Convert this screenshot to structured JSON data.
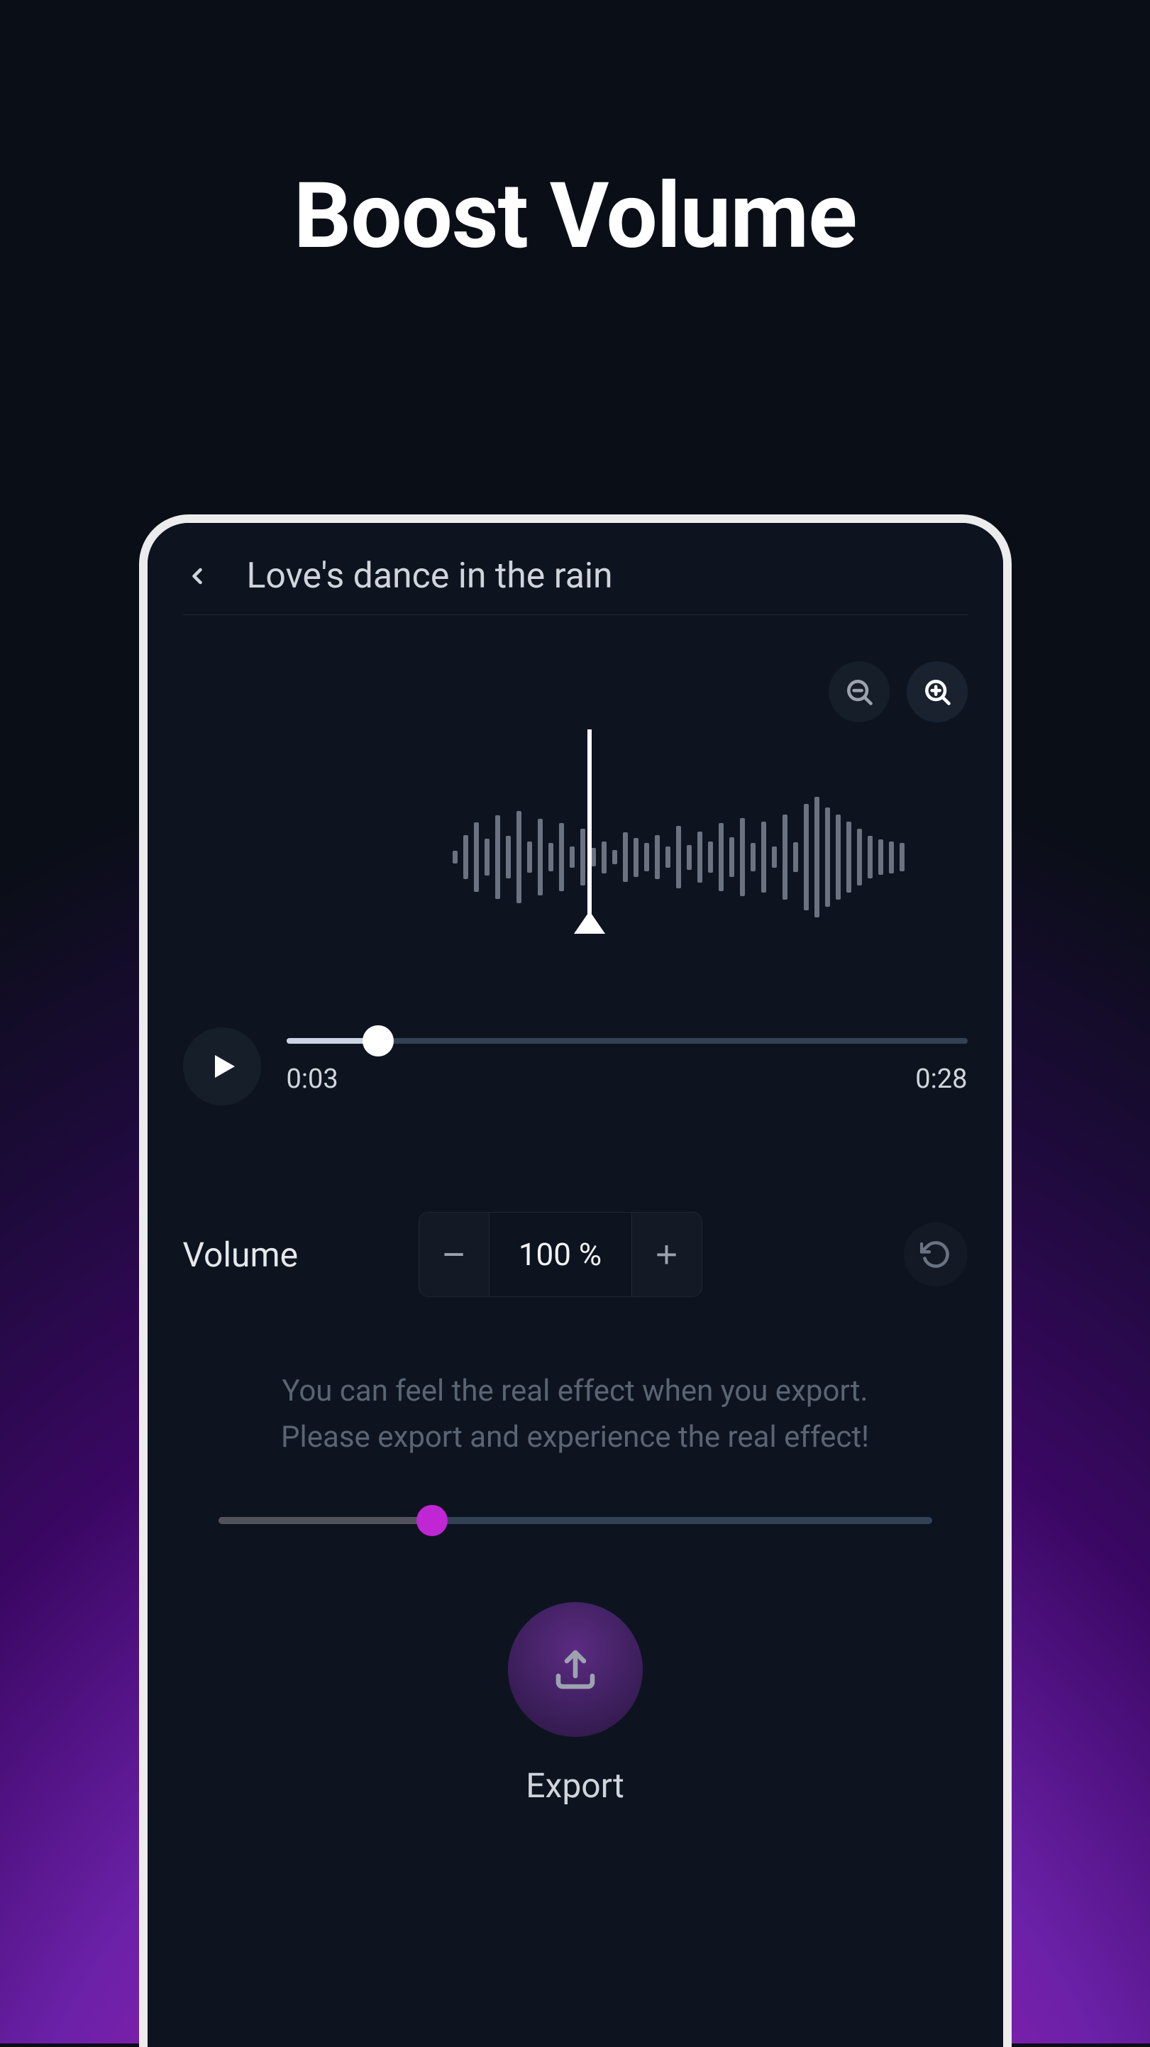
{
  "page": {
    "title": "Boost Volume"
  },
  "header": {
    "song_title": "Love's dance in the rain"
  },
  "playback": {
    "current_time": "0:03",
    "total_time": "0:28",
    "progress_pct": 13.5
  },
  "volume": {
    "label": "Volume",
    "value": "100 %",
    "minus": "−",
    "plus": "+"
  },
  "hint": {
    "line1": "You can feel the real effect when you export.",
    "line2": "Please export and experience the real effect!"
  },
  "boost": {
    "pct": 30
  },
  "export": {
    "label": "Export"
  },
  "icons": {
    "back": "chevron-left",
    "zoom_out": "zoom-out",
    "zoom_in": "zoom-in",
    "play": "play",
    "reset": "rotate-ccw",
    "upload": "upload"
  },
  "waveform_bars": [
    18,
    62,
    98,
    52,
    118,
    60,
    130,
    44,
    108,
    40,
    96,
    30,
    80,
    26,
    45,
    20,
    70,
    55,
    40,
    62,
    30,
    88,
    35,
    72,
    44,
    96,
    56,
    110,
    40,
    100,
    30,
    120,
    42,
    150,
    170,
    140,
    120,
    100,
    80,
    60,
    50,
    45,
    40
  ]
}
